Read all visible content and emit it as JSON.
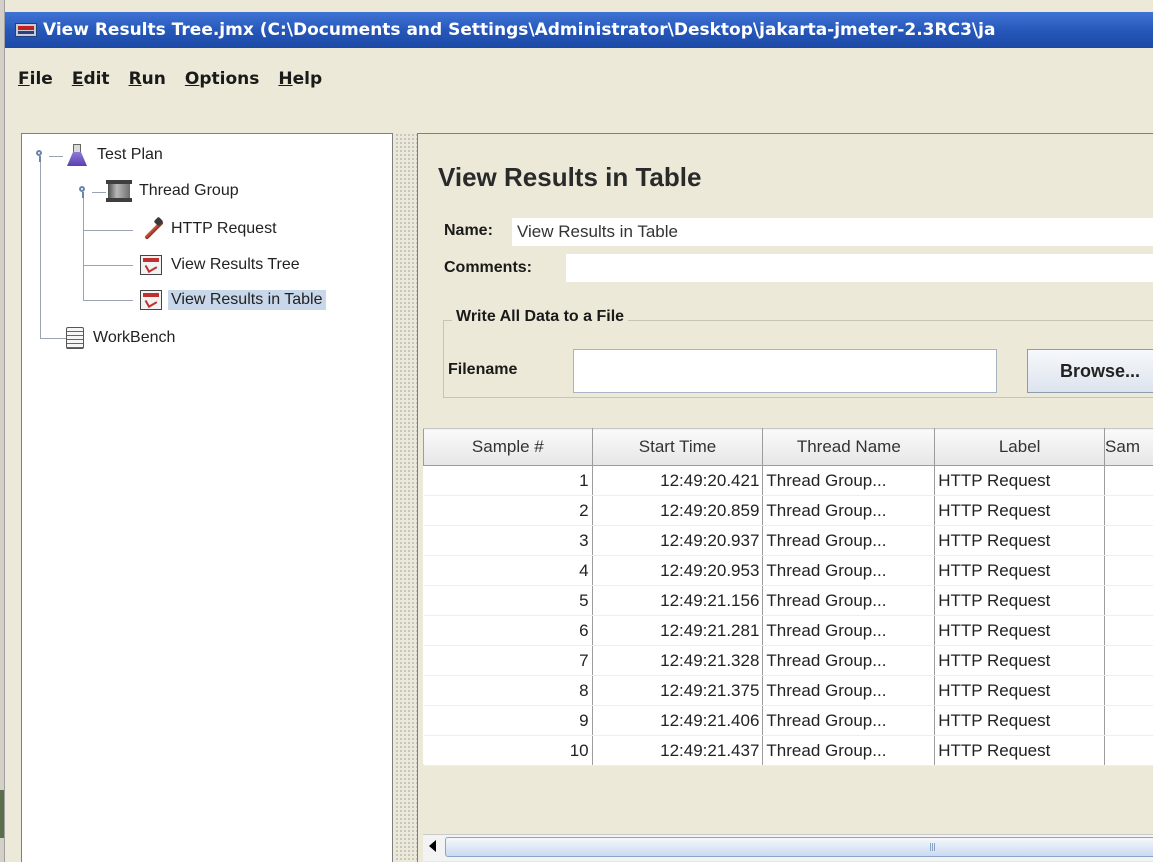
{
  "window": {
    "title": "View Results Tree.jmx (C:\\Documents and Settings\\Administrator\\Desktop\\jakarta-jmeter-2.3RC3\\ja"
  },
  "menu": [
    {
      "accel": "F",
      "rest": "ile"
    },
    {
      "accel": "E",
      "rest": "dit"
    },
    {
      "accel": "R",
      "rest": "un"
    },
    {
      "accel": "O",
      "rest": "ptions"
    },
    {
      "accel": "H",
      "rest": "elp"
    }
  ],
  "tree": {
    "test_plan": "Test Plan",
    "thread_group": "Thread Group",
    "http_request": "HTTP Request",
    "view_results_tree": "View Results Tree",
    "view_results_table": "View Results in Table",
    "workbench": "WorkBench"
  },
  "icons": {
    "test_plan": "flask-icon",
    "thread_group": "spool-icon",
    "http_request": "pipette-icon",
    "listener": "listener-icon",
    "workbench": "workbench-icon"
  },
  "panel": {
    "title": "View Results in Table",
    "name_label": "Name:",
    "name_value": "View Results in Table",
    "comments_label": "Comments:",
    "comments_value": "",
    "file_group_title": "Write All Data to a File",
    "filename_label": "Filename",
    "filename_value": "",
    "browse_label": "Browse..."
  },
  "table": {
    "columns": [
      "Sample #",
      "Start Time",
      "Thread Name",
      "Label",
      "Sam"
    ],
    "rows": [
      [
        "1",
        "12:49:20.421",
        "Thread Group...",
        "HTTP Request",
        ""
      ],
      [
        "2",
        "12:49:20.859",
        "Thread Group...",
        "HTTP Request",
        ""
      ],
      [
        "3",
        "12:49:20.937",
        "Thread Group...",
        "HTTP Request",
        ""
      ],
      [
        "4",
        "12:49:20.953",
        "Thread Group...",
        "HTTP Request",
        ""
      ],
      [
        "5",
        "12:49:21.156",
        "Thread Group...",
        "HTTP Request",
        ""
      ],
      [
        "6",
        "12:49:21.281",
        "Thread Group...",
        "HTTP Request",
        ""
      ],
      [
        "7",
        "12:49:21.328",
        "Thread Group...",
        "HTTP Request",
        ""
      ],
      [
        "8",
        "12:49:21.375",
        "Thread Group...",
        "HTTP Request",
        ""
      ],
      [
        "9",
        "12:49:21.406",
        "Thread Group...",
        "HTTP Request",
        ""
      ],
      [
        "10",
        "12:49:21.437",
        "Thread Group...",
        "HTTP Request",
        ""
      ]
    ]
  },
  "colors": {
    "title_bar": "#2456b8",
    "selection": "#c8d8ea",
    "background": "#ece9d8"
  }
}
